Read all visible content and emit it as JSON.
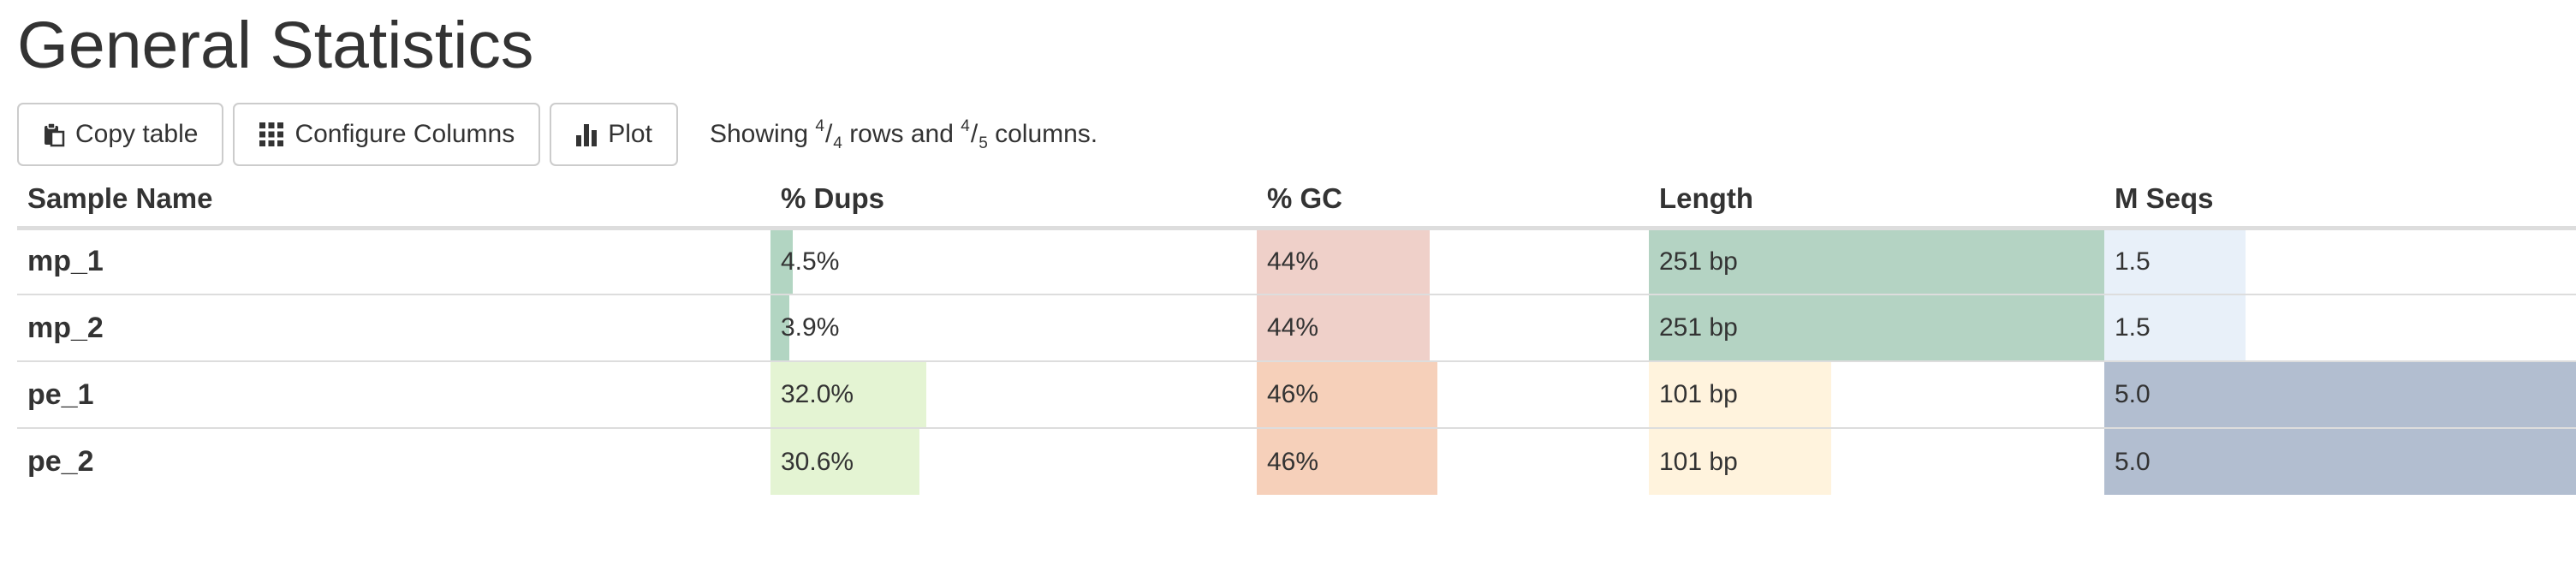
{
  "page": {
    "title": "General Statistics"
  },
  "toolbar": {
    "copy_label": "Copy table",
    "configure_label": "Configure Columns",
    "plot_label": "Plot",
    "showing_prefix": "Showing ",
    "rows_shown": "4",
    "rows_total": "4",
    "rows_suffix": " rows and ",
    "cols_shown": "4",
    "cols_total": "5",
    "cols_suffix": " columns."
  },
  "table": {
    "headers": {
      "sample": "Sample Name",
      "dups": "% Dups",
      "gc": "% GC",
      "length": "Length",
      "mseqs": "M Seqs"
    },
    "rows": [
      {
        "name": "mp_1",
        "dups": "4.5%",
        "gc": "44%",
        "length": "251 bp",
        "mseqs": "1.5",
        "dups_pct": 4.5,
        "gc_pct": 44,
        "length_pct": 100,
        "mseqs_pct": 30
      },
      {
        "name": "mp_2",
        "dups": "3.9%",
        "gc": "44%",
        "length": "251 bp",
        "mseqs": "1.5",
        "dups_pct": 3.9,
        "gc_pct": 44,
        "length_pct": 100,
        "mseqs_pct": 30
      },
      {
        "name": "pe_1",
        "dups": "32.0%",
        "gc": "46%",
        "length": "101 bp",
        "mseqs": "5.0",
        "dups_pct": 32.0,
        "gc_pct": 46,
        "length_pct": 40,
        "mseqs_pct": 100
      },
      {
        "name": "pe_2",
        "dups": "30.6%",
        "gc": "46%",
        "length": "101 bp",
        "mseqs": "5.0",
        "dups_pct": 30.6,
        "gc_pct": 46,
        "length_pct": 40,
        "mseqs_pct": 100
      }
    ]
  },
  "colors": {
    "dups_low": "#b2d5c2",
    "dups_high": "#e4f4d3",
    "gc_44": "#efd0c9",
    "gc_46": "#f6d0ba",
    "length_251": "#b4d3c3",
    "length_101": "#fff3dd",
    "mseqs_low": "#e8f0f9",
    "mseqs_high": "#b2bed0",
    "border": "#dddddd"
  },
  "icons": {
    "copy": "clipboard-icon",
    "configure": "grid-icon",
    "plot": "bar-chart-icon"
  }
}
